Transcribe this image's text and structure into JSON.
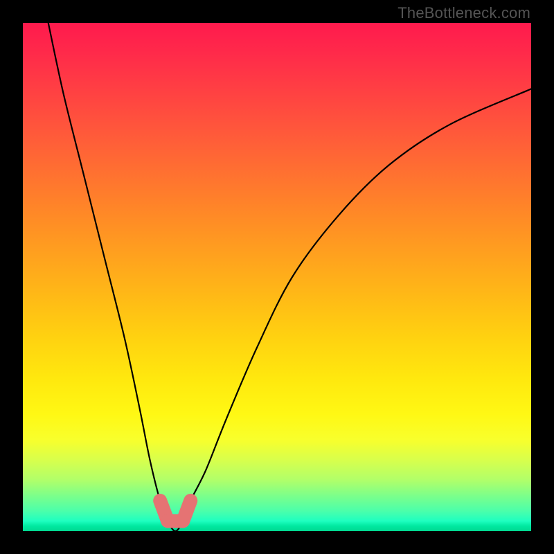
{
  "watermark": "TheBottleneck.com",
  "colors": {
    "curve_stroke": "#000000",
    "marker_fill": "#e57373",
    "marker_stroke": "#c45858",
    "frame_bg": "#000000"
  },
  "chart_data": {
    "type": "line",
    "title": "",
    "xlabel": "",
    "ylabel": "",
    "xlim": [
      0,
      100
    ],
    "ylim": [
      0,
      100
    ],
    "series": [
      {
        "name": "bottleneck-curve",
        "x": [
          5,
          8,
          12,
          16,
          20,
          23,
          25,
          27,
          28.5,
          30,
          31.5,
          33,
          36,
          40,
          46,
          53,
          62,
          72,
          84,
          100
        ],
        "values": [
          100,
          86,
          70,
          54,
          38,
          24,
          14,
          6,
          2,
          0,
          2,
          6,
          12,
          22,
          36,
          50,
          62,
          72,
          80,
          87
        ]
      }
    ],
    "markers": {
      "name": "highlight-segment",
      "x": [
        27,
        28.5,
        30,
        31.5,
        33
      ],
      "values": [
        6,
        2,
        0,
        2,
        6
      ]
    }
  }
}
